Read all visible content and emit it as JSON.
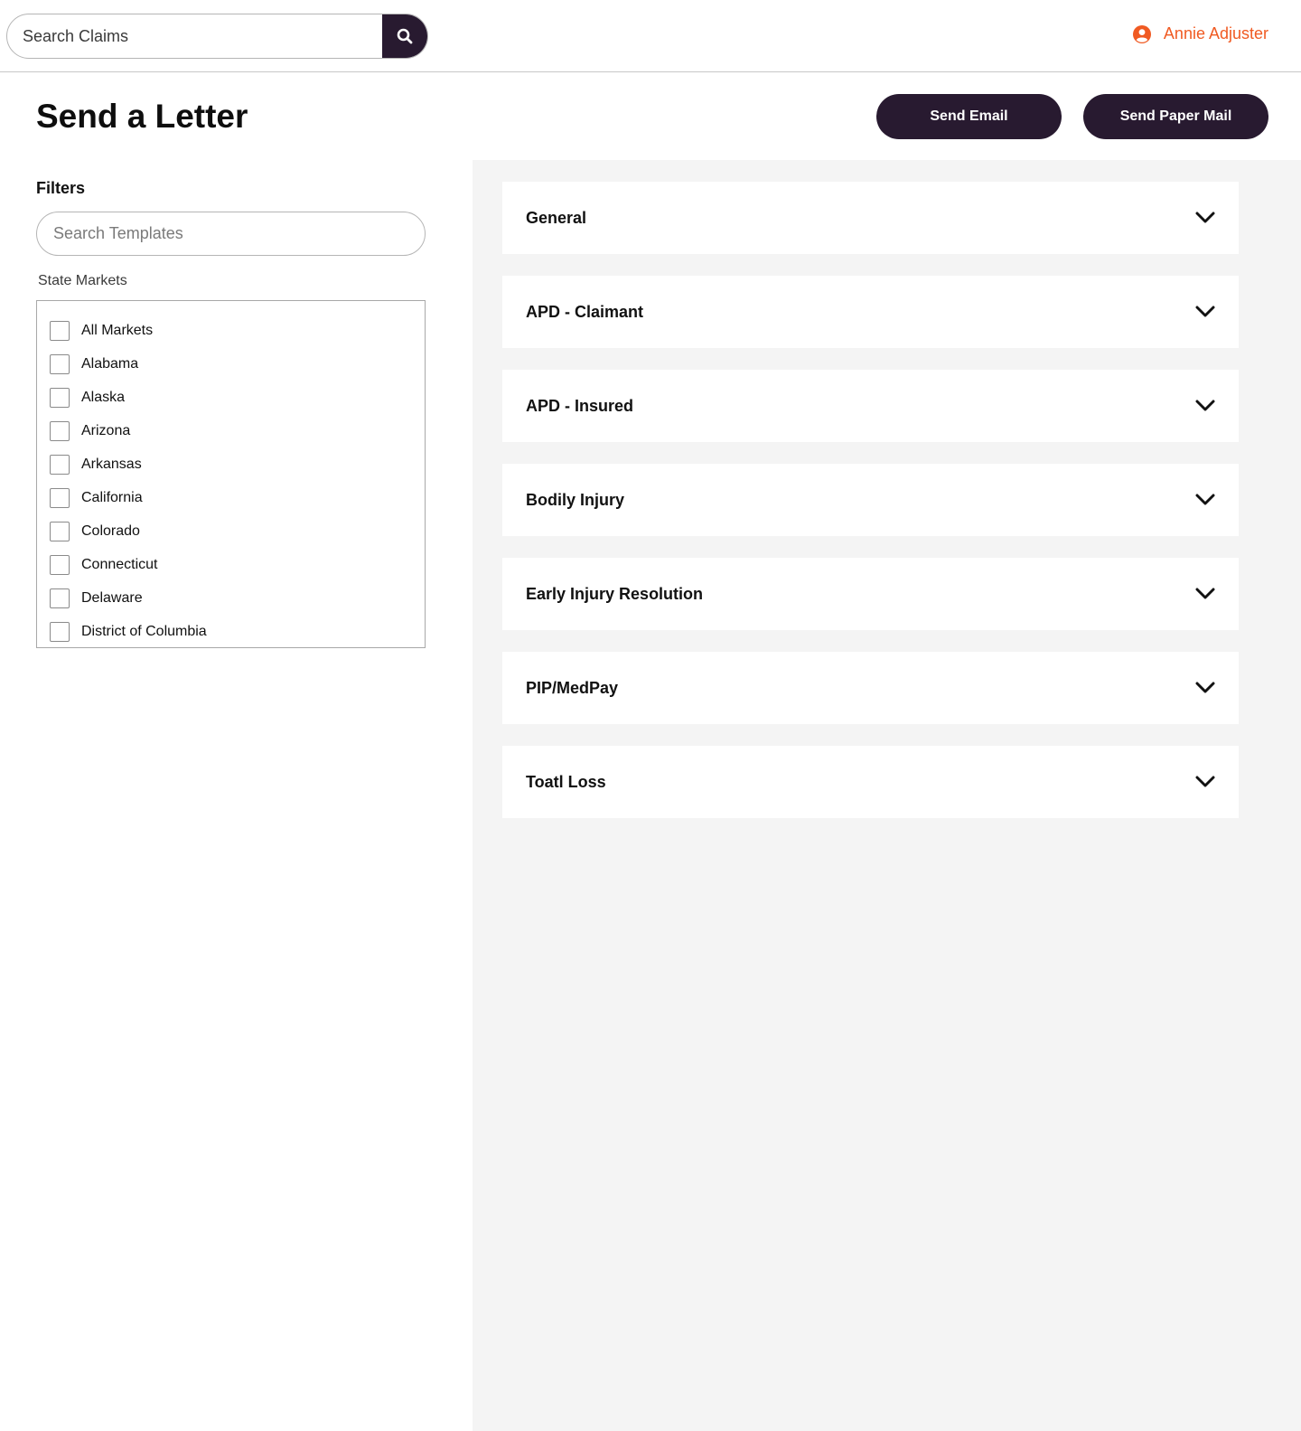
{
  "header": {
    "search_placeholder": "Search Claims",
    "search_icon": "search-icon",
    "user_name": "Annie Adjuster",
    "user_icon": "user-circle-icon"
  },
  "page": {
    "title": "Send a Letter",
    "send_email_label": "Send Email",
    "send_paper_label": "Send Paper Mail"
  },
  "filters": {
    "label": "Filters",
    "template_search_placeholder": "Search Templates",
    "markets_label": "State Markets",
    "markets": [
      "All Markets",
      "Alabama",
      "Alaska",
      "Arizona",
      "Arkansas",
      "California",
      "Colorado",
      "Connecticut",
      "Delaware",
      "District of Columbia"
    ]
  },
  "categories": [
    "General",
    "APD - Claimant",
    "APD - Insured",
    "Bodily Injury",
    "Early Injury Resolution",
    "PIP/MedPay",
    "Toatl Loss"
  ],
  "colors": {
    "primary": "#281a30",
    "accent": "#f05a22",
    "panel_bg": "#f4f4f4"
  }
}
